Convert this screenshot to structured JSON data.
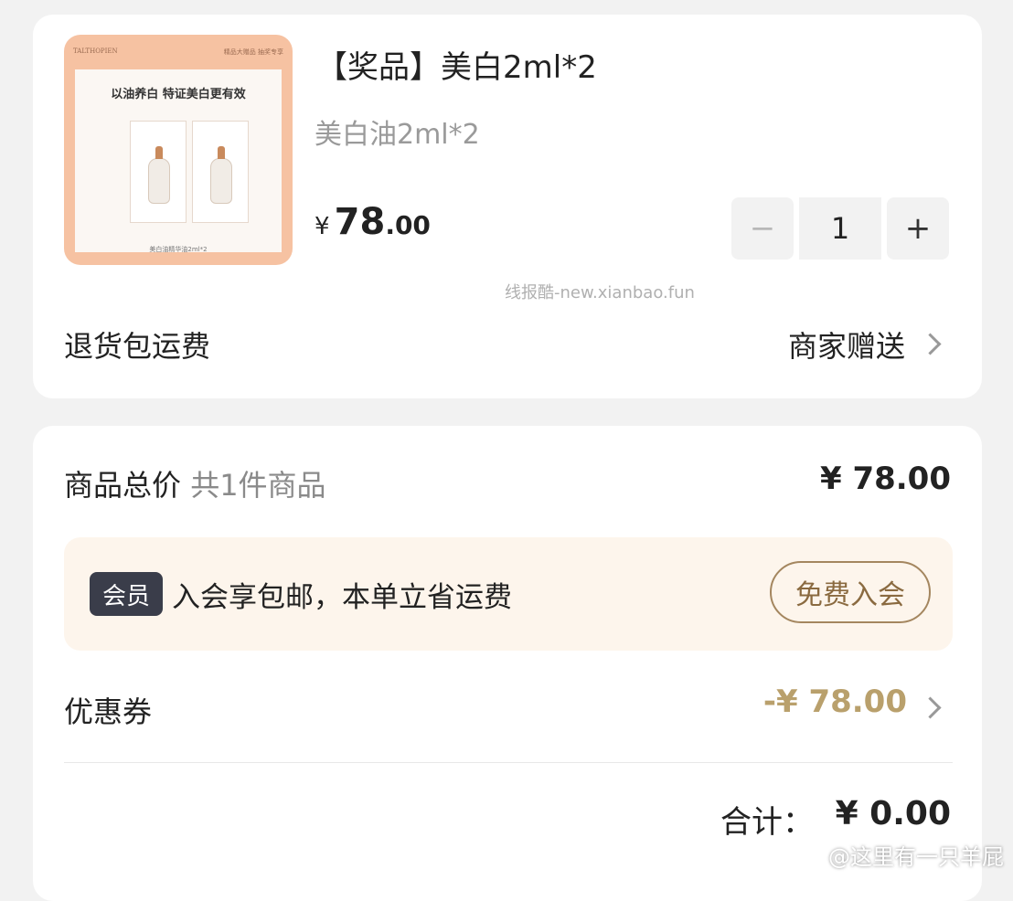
{
  "product": {
    "image": {
      "brand": "TALTHOPIEN",
      "tag": "精品大赠品 抽奖专享",
      "headline": "以油养白 特证美白更有效",
      "caption": "美白油精华油2ml*2"
    },
    "title": "【奖品】美白2ml*2",
    "subtitle": "美白油2ml*2",
    "price": {
      "currency": "¥",
      "integer": "78",
      "decimal": ".00"
    },
    "quantity": {
      "minus": "−",
      "value": "1",
      "plus": "+"
    }
  },
  "watermark": "线报酷-new.xianbao.fun",
  "return_shipping": {
    "label": "退货包运费",
    "value": "商家赠送"
  },
  "summary": {
    "goods_label": "商品总价",
    "goods_count": "共1件商品",
    "goods_total": "¥ 78.00",
    "member": {
      "badge": "会员",
      "text": "入会享包邮，本单立省运费",
      "button": "免费入会"
    },
    "coupon": {
      "label": "优惠券",
      "value": "-¥ 78.00"
    },
    "total": {
      "label": "合计：",
      "value": "¥ 0.00"
    }
  },
  "weibo_watermark": "@这里有一只羊屁",
  "colors": {
    "background": "#f2f2f2",
    "card": "#ffffff",
    "coupon_gold": "#b9a06c",
    "member_bg": "#fdf5ec",
    "member_badge": "#3a3d4a",
    "member_button_border": "#a4865f"
  }
}
